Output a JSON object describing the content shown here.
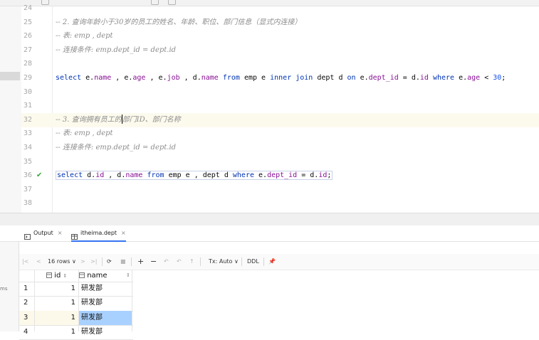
{
  "editor": {
    "lines": [
      {
        "num": "24",
        "tokens": []
      },
      {
        "num": "25",
        "tokens": [
          {
            "t": "-- 2. 查询年龄小于30岁的员工的姓名、年龄、职位、部门信息（显式内连接）",
            "c": "cm"
          }
        ]
      },
      {
        "num": "26",
        "tokens": [
          {
            "t": "-- 表: emp , dept",
            "c": "cm"
          }
        ]
      },
      {
        "num": "27",
        "tokens": [
          {
            "t": "-- 连接条件: emp.dept_id = dept.id",
            "c": "cm"
          }
        ]
      },
      {
        "num": "28",
        "tokens": []
      },
      {
        "num": "29",
        "tokens": [
          {
            "t": "select",
            "c": "kw"
          },
          {
            "t": " e.",
            "c": ""
          },
          {
            "t": "name",
            "c": "fd"
          },
          {
            "t": " , e.",
            "c": ""
          },
          {
            "t": "age",
            "c": "fd"
          },
          {
            "t": " , e.",
            "c": ""
          },
          {
            "t": "job",
            "c": "fd"
          },
          {
            "t": " , d.",
            "c": ""
          },
          {
            "t": "name",
            "c": "fd"
          },
          {
            "t": " ",
            "c": ""
          },
          {
            "t": "from",
            "c": "kw"
          },
          {
            "t": " emp e ",
            "c": ""
          },
          {
            "t": "inner join",
            "c": "kw"
          },
          {
            "t": " dept d ",
            "c": ""
          },
          {
            "t": "on",
            "c": "kw"
          },
          {
            "t": " e.",
            "c": ""
          },
          {
            "t": "dept_id",
            "c": "fd"
          },
          {
            "t": " = d.",
            "c": ""
          },
          {
            "t": "id",
            "c": "fd"
          },
          {
            "t": " ",
            "c": ""
          },
          {
            "t": "where",
            "c": "kw"
          },
          {
            "t": " e.",
            "c": ""
          },
          {
            "t": "age",
            "c": "fd"
          },
          {
            "t": " < ",
            "c": ""
          },
          {
            "t": "30",
            "c": "nm"
          },
          {
            "t": ";",
            "c": ""
          }
        ]
      },
      {
        "num": "30",
        "tokens": []
      },
      {
        "num": "31",
        "tokens": []
      },
      {
        "num": "32",
        "tokens": [
          {
            "t": "-- 3. 查询拥有员工的",
            "c": "cm"
          },
          {
            "t": "",
            "c": "caret"
          },
          {
            "t": "部门ID、部门名称",
            "c": "cm"
          }
        ],
        "current": true
      },
      {
        "num": "33",
        "tokens": [
          {
            "t": "-- 表: emp , dept",
            "c": "cm"
          }
        ]
      },
      {
        "num": "34",
        "tokens": [
          {
            "t": "-- 连接条件: emp.dept_id = dept.id",
            "c": "cm"
          }
        ]
      },
      {
        "num": "35",
        "tokens": []
      },
      {
        "num": "36",
        "tokens": [
          {
            "t": "select",
            "c": "kw"
          },
          {
            "t": " d.",
            "c": ""
          },
          {
            "t": "id",
            "c": "fd"
          },
          {
            "t": " , d.",
            "c": ""
          },
          {
            "t": "name",
            "c": "fd"
          },
          {
            "t": " ",
            "c": ""
          },
          {
            "t": "from",
            "c": "kw"
          },
          {
            "t": " emp e , dept d ",
            "c": ""
          },
          {
            "t": "where",
            "c": "kw"
          },
          {
            "t": " e.",
            "c": ""
          },
          {
            "t": "dept_id",
            "c": "fd"
          },
          {
            "t": " = d.",
            "c": ""
          },
          {
            "t": "id",
            "c": "fd"
          },
          {
            "t": ";",
            "c": ""
          }
        ],
        "ok": true,
        "boxed": true
      },
      {
        "num": "37",
        "tokens": []
      },
      {
        "num": "38",
        "tokens": []
      }
    ]
  },
  "tabs": {
    "output_label": "Output",
    "result_label": "itheima.dept",
    "close_glyph": "×"
  },
  "toolbar": {
    "first_glyph": "|<",
    "prev_glyph": "<",
    "rows_label": "16 rows",
    "rows_caret": "∨",
    "next_glyph": ">",
    "last_glyph": ">|",
    "refresh_glyph": "⟳",
    "stop_glyph": "■",
    "add_glyph": "+",
    "remove_glyph": "−",
    "revert_glyph": "↶",
    "submit_glyph": "↑",
    "tx_label": "Tx: Auto",
    "tx_caret": "∨",
    "ddl_label": "DDL",
    "pin_glyph": "📌"
  },
  "left_pane": {
    "label": "ms"
  },
  "grid": {
    "columns": [
      {
        "label": "id",
        "sort": "⇕"
      },
      {
        "label": "name",
        "sort": "⇕"
      }
    ],
    "rows": [
      {
        "num": "1",
        "id": "1",
        "name": "研发部"
      },
      {
        "num": "2",
        "id": "1",
        "name": "研发部"
      },
      {
        "num": "3",
        "id": "1",
        "name": "研发部",
        "selected": true
      },
      {
        "num": "4",
        "id": "1",
        "name": "研发部"
      }
    ]
  },
  "colors": {
    "keyword": "#0033b3",
    "field": "#871094",
    "number": "#1750eb",
    "comment": "#8c8c8c",
    "selected_cell": "#a9d1ff",
    "accent_tab": "#3574f0",
    "ok_check": "#3aa63a"
  }
}
